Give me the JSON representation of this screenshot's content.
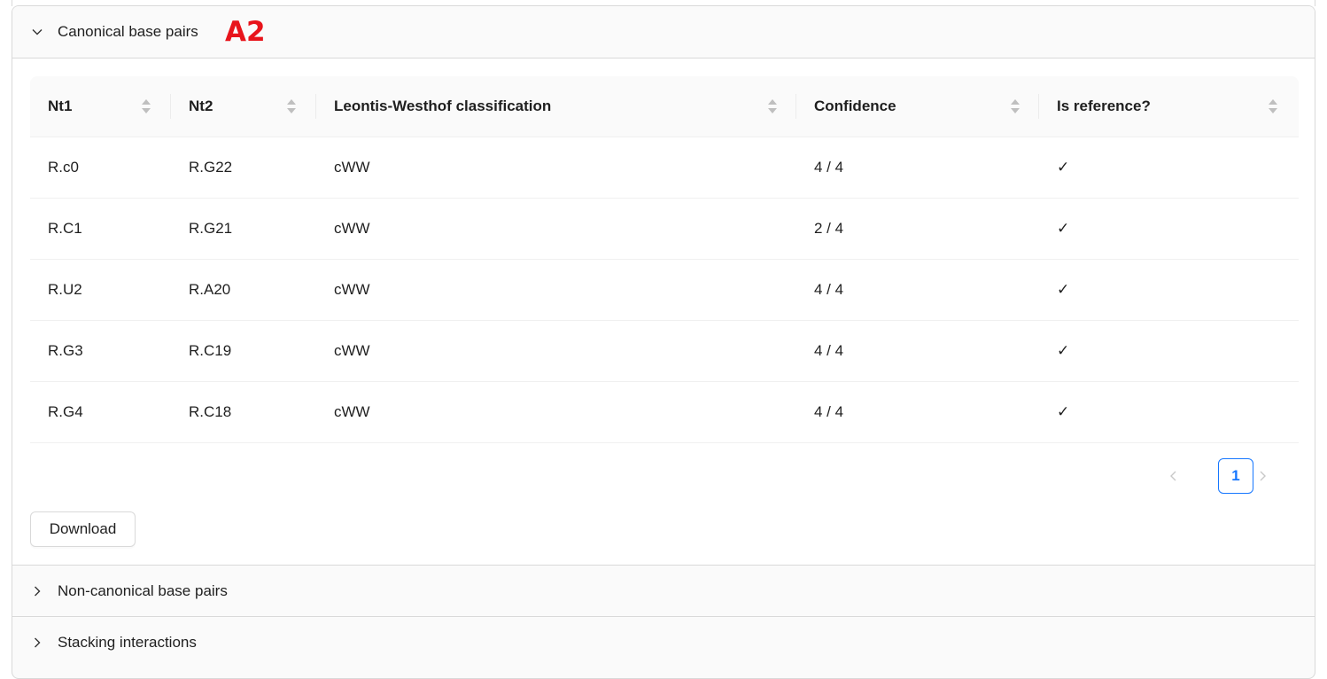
{
  "panels": {
    "canonical": {
      "title": "Canonical base pairs",
      "tag": "A2"
    },
    "non_canonical": {
      "title": "Non-canonical base pairs"
    },
    "stacking": {
      "title": "Stacking interactions"
    }
  },
  "table": {
    "columns": [
      "Nt1",
      "Nt2",
      "Leontis-Westhof classification",
      "Confidence",
      "Is reference?"
    ],
    "rows": [
      [
        "R.c0",
        "R.G22",
        "cWW",
        "4 / 4",
        "✓"
      ],
      [
        "R.C1",
        "R.G21",
        "cWW",
        "2 / 4",
        "✓"
      ],
      [
        "R.U2",
        "R.A20",
        "cWW",
        "4 / 4",
        "✓"
      ],
      [
        "R.G3",
        "R.C19",
        "cWW",
        "4 / 4",
        "✓"
      ],
      [
        "R.G4",
        "R.C18",
        "cWW",
        "4 / 4",
        "✓"
      ]
    ]
  },
  "pagination": {
    "current_page": "1",
    "prev_icon": "chevron-left-icon",
    "next_icon": "chevron-right-icon"
  },
  "actions": {
    "download_label": "Download"
  },
  "colors": {
    "accent": "#1677ff",
    "tag_red": "#e8141b",
    "header_bg": "#fafafa",
    "border": "#d9d9d9"
  }
}
